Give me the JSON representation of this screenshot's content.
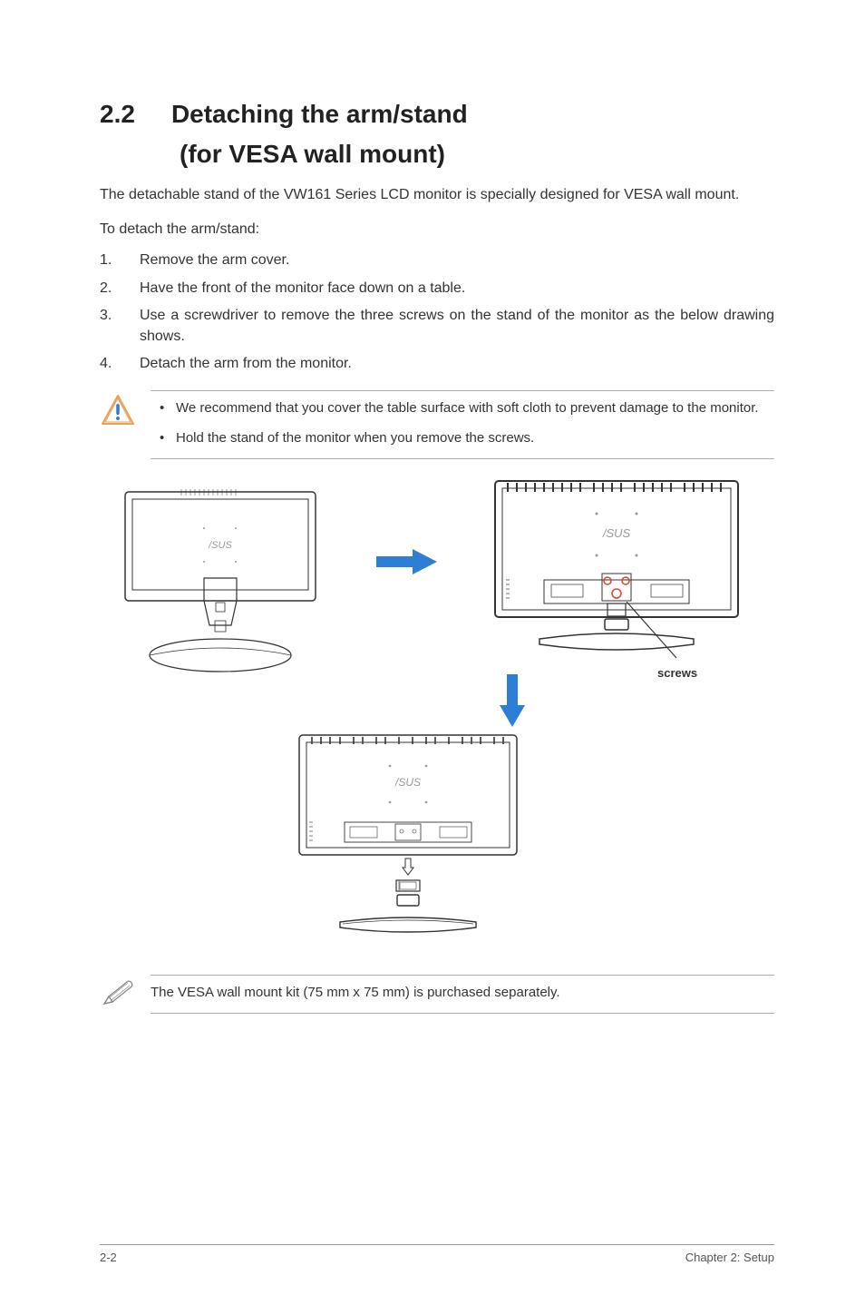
{
  "section": {
    "number": "2.2",
    "title_line1": "Detaching the arm/stand",
    "title_line2": "(for VESA wall mount)"
  },
  "intro": "The detachable stand of the VW161 Series LCD monitor is specially designed for VESA wall mount.",
  "subhead": "To detach the arm/stand:",
  "steps": [
    {
      "num": "1.",
      "text": "Remove the arm cover."
    },
    {
      "num": "2.",
      "text": "Have the front of the monitor face down on a table."
    },
    {
      "num": "3.",
      "text": "Use a screwdriver to remove the three screws on the stand of the monitor as the below drawing shows."
    },
    {
      "num": "4.",
      "text": "Detach the arm from the monitor."
    }
  ],
  "warning": {
    "items": [
      "We recommend that you cover the table surface with soft cloth to prevent damage to the monitor.",
      "Hold the stand of the monitor when you remove the screws."
    ]
  },
  "diagram": {
    "screws_label": "screws"
  },
  "note": "The VESA wall mount kit (75 mm x 75 mm) is purchased separately.",
  "footer": {
    "left": "2-2",
    "right": "Chapter 2: Setup"
  }
}
